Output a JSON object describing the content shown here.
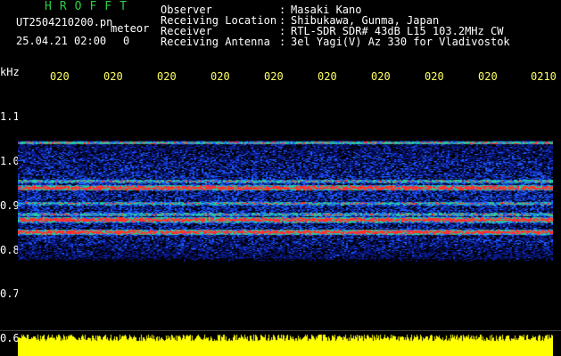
{
  "header": {
    "app_title": "HROFFT",
    "file_name": "UT2504210200.pn",
    "meteor_label": "meteor",
    "date_time": "25.04.21 02:00",
    "meteor_count": "0"
  },
  "info": [
    {
      "label": "Observer",
      "value": "Masaki Kano"
    },
    {
      "label": "Receiving Location",
      "value": "Shibukawa, Gunma, Japan"
    },
    {
      "label": "Receiver",
      "value": "RTL-SDR SDR# 43dB L15 103.2MHz CW"
    },
    {
      "label": "Receiving Antenna",
      "value": "3el Yagi(V) Az 330 for Vladivostok"
    }
  ],
  "y_axis": {
    "unit": "kHz",
    "ticks": [
      "1.1",
      "1.0",
      "0.9",
      "0.8",
      "0.7",
      "0.6"
    ]
  },
  "x_axis": {
    "ticks": [
      "020",
      "020",
      "020",
      "020",
      "020",
      "020",
      "020",
      "020",
      "020",
      "0210"
    ]
  },
  "spectrogram": {
    "band_top_khz": 1.045,
    "band_bottom_khz": 0.78,
    "strong_lines_khz": [
      0.94,
      0.868,
      0.84
    ],
    "medium_lines_khz": [
      0.955,
      0.905,
      0.88,
      0.865
    ],
    "top_edge_line_khz": 1.042,
    "colors": {
      "background": "#000000",
      "noise_low": "#0a1a8c",
      "noise_mid": "#1e5cff",
      "signal_mid": "#28c8a0",
      "signal_high": "#ff3030",
      "title": "#2ecc40",
      "ticks": "#ffff66",
      "level_bar": "#ffff00"
    }
  }
}
